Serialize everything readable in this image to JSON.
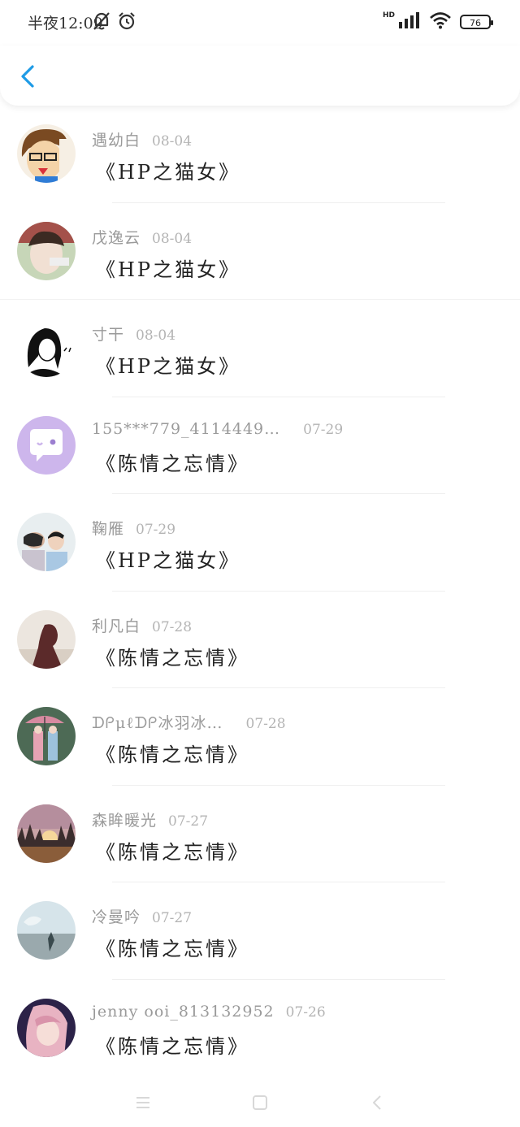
{
  "status_bar": {
    "time": "半夜12:09",
    "icons_left": [
      "mute-bell-icon",
      "alarm-clock-icon"
    ],
    "icons_right": [
      "hd-signal-icon",
      "wifi-icon",
      "battery-icon"
    ],
    "hd_label": "HD",
    "battery_level": "76"
  },
  "header": {
    "back_icon": "chevron-left-icon",
    "accent_color": "#1e9be6"
  },
  "list": [
    {
      "name": "遇幼白",
      "date": "08-04",
      "title": "《HP之猫女》"
    },
    {
      "name": "戊逸云",
      "date": "08-04",
      "title": "《HP之猫女》"
    },
    {
      "name": "寸干",
      "date": "08-04",
      "title": "《HP之猫女》"
    },
    {
      "name": "155***779_4114449…",
      "date": "07-29",
      "title": "《陈情之忘情》"
    },
    {
      "name": "鞠雁",
      "date": "07-29",
      "title": "《HP之猫女》"
    },
    {
      "name": "利凡白",
      "date": "07-28",
      "title": "《陈情之忘情》"
    },
    {
      "name": "ᗪᑭμℓᗪᑭ冰羽冰…",
      "date": "07-28",
      "title": "《陈情之忘情》"
    },
    {
      "name": "森眸暖光",
      "date": "07-27",
      "title": "《陈情之忘情》"
    },
    {
      "name": "冷曼吟",
      "date": "07-27",
      "title": "《陈情之忘情》"
    },
    {
      "name": "jenny ooi_813132952",
      "date": "07-26",
      "title": "《陈情之忘情》"
    }
  ],
  "navbar": {
    "icons": [
      "menu-icon",
      "home-square-icon",
      "back-triangle-icon"
    ]
  }
}
